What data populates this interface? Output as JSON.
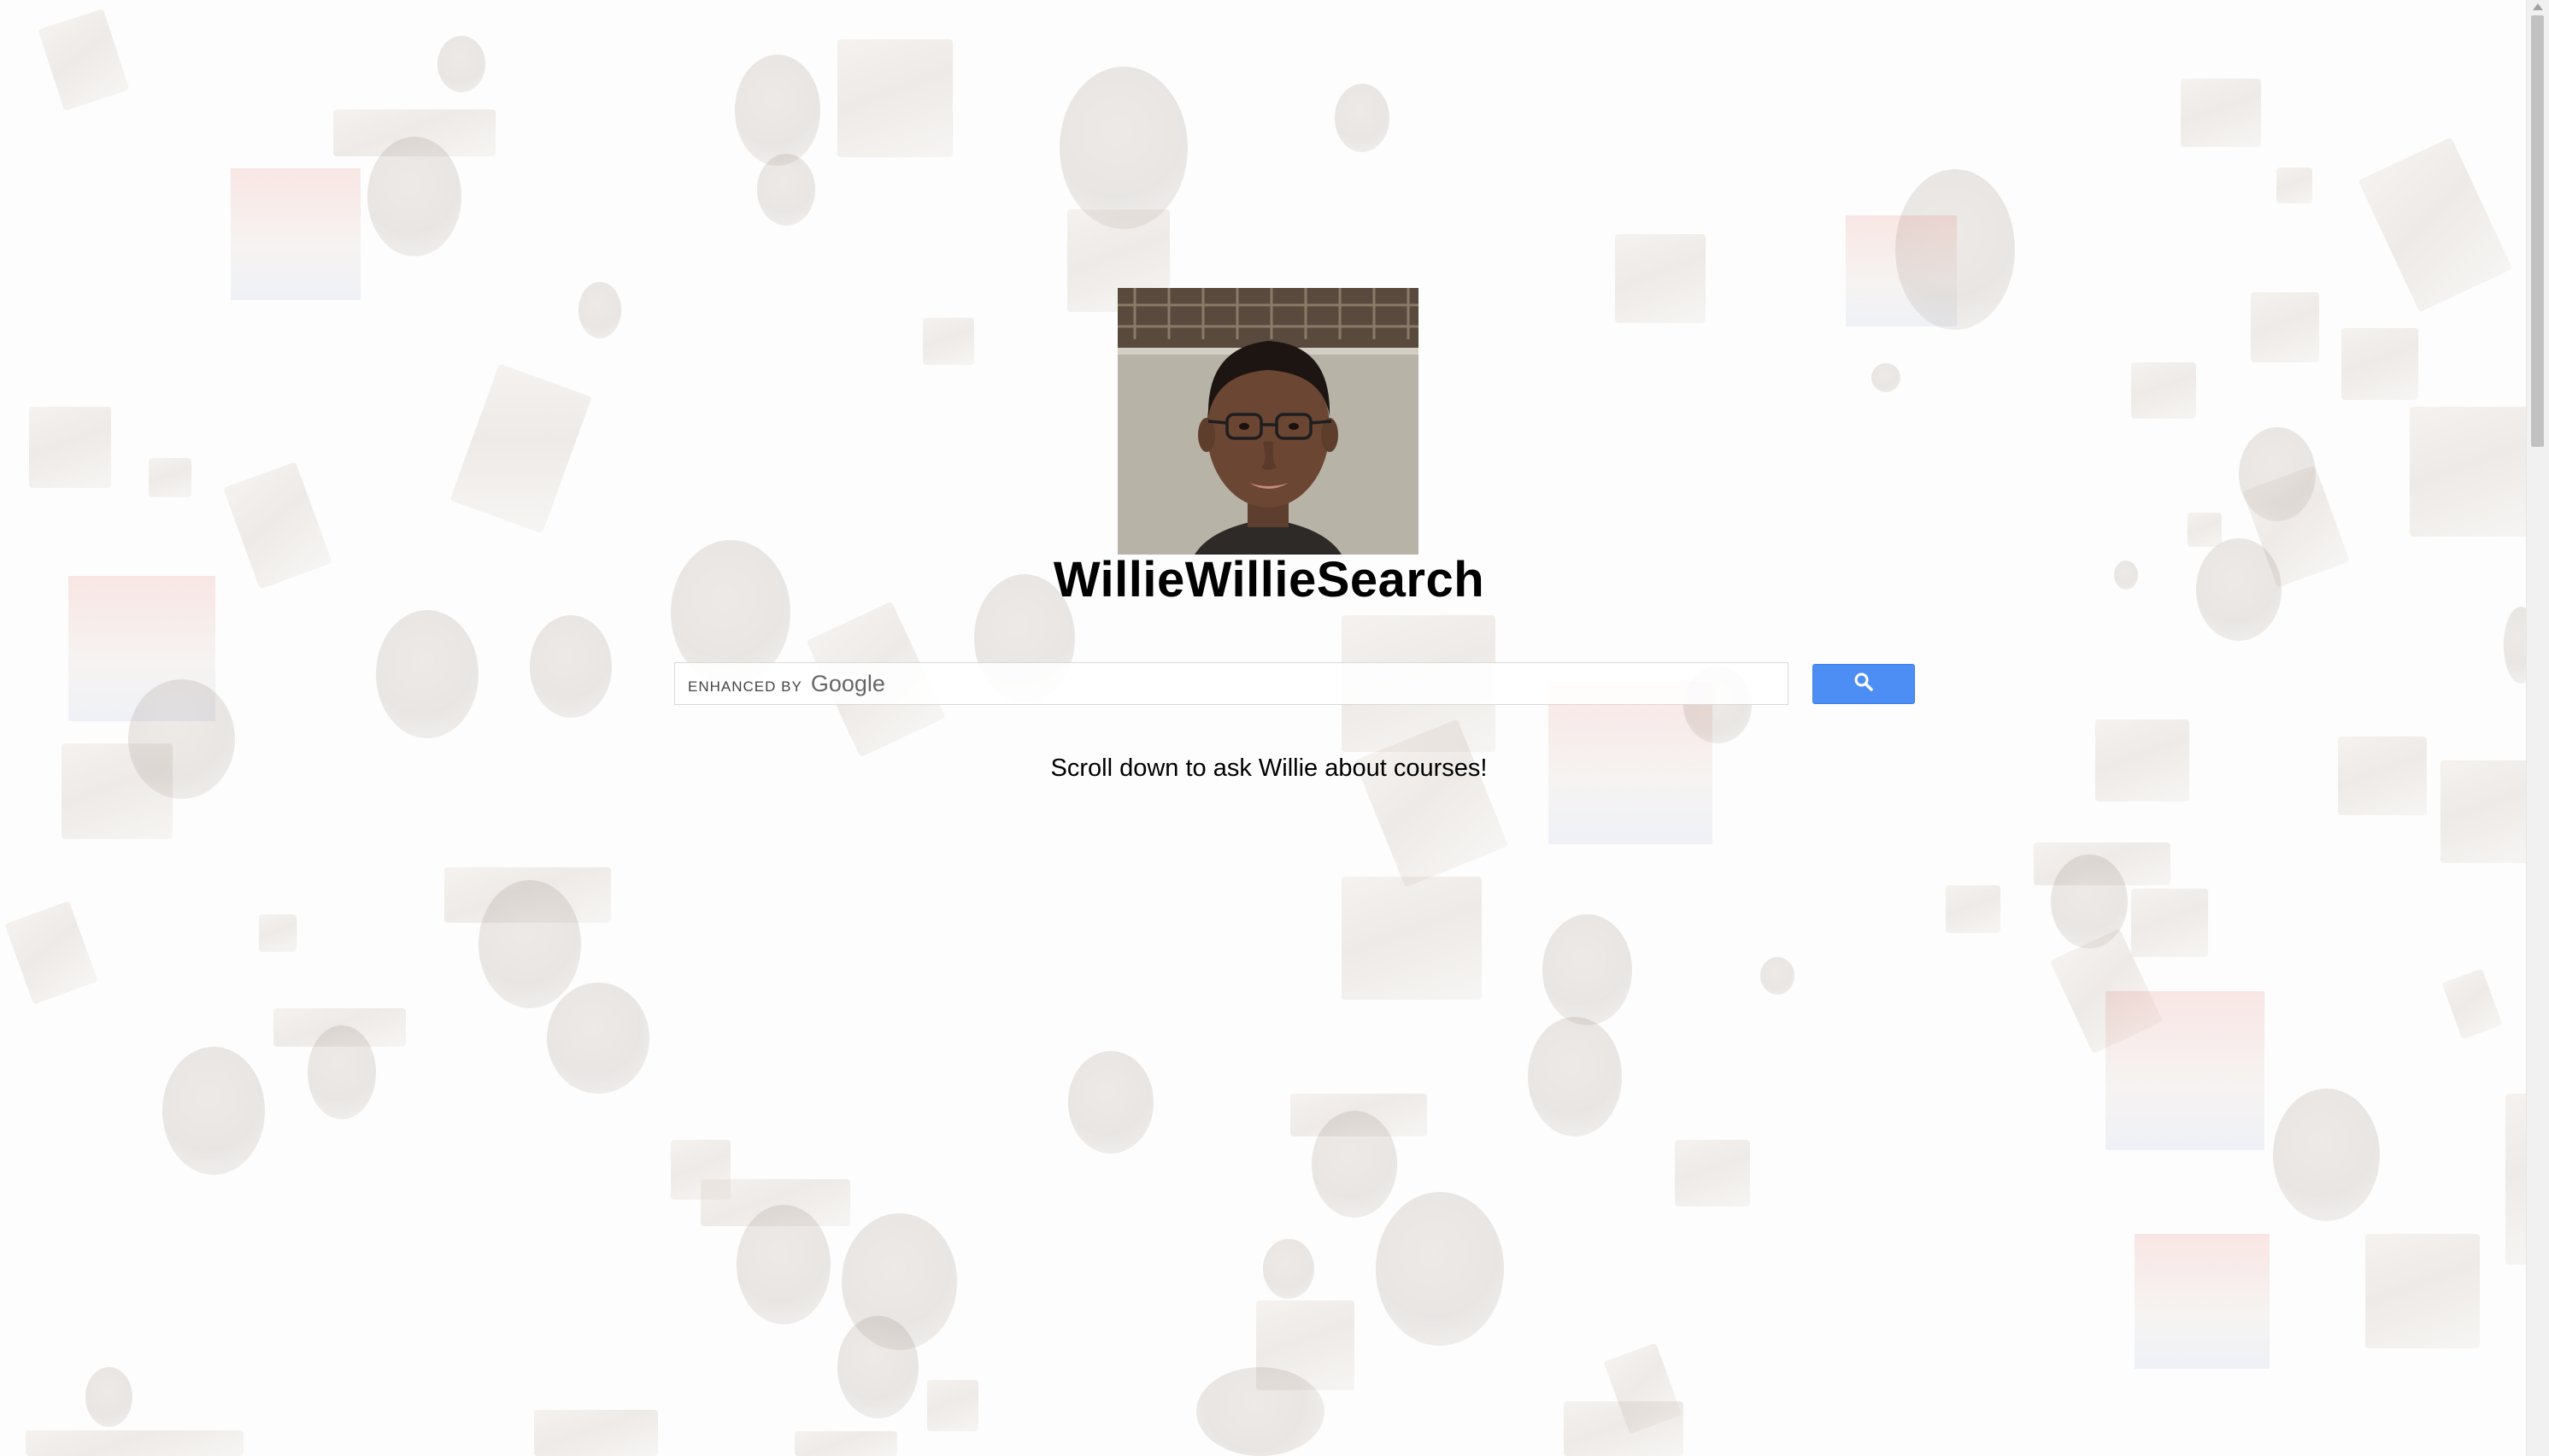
{
  "site": {
    "title": "WillieWillieSearch",
    "tagline": "Scroll down to ask Willie about courses!"
  },
  "search": {
    "watermark_prefix": "ENHANCED BY",
    "watermark_brand": "Google",
    "value": "",
    "button_icon": "search-icon"
  },
  "colors": {
    "search_button": "#4d8ef4",
    "title_text": "#000000",
    "background": "#fdfdfd"
  }
}
